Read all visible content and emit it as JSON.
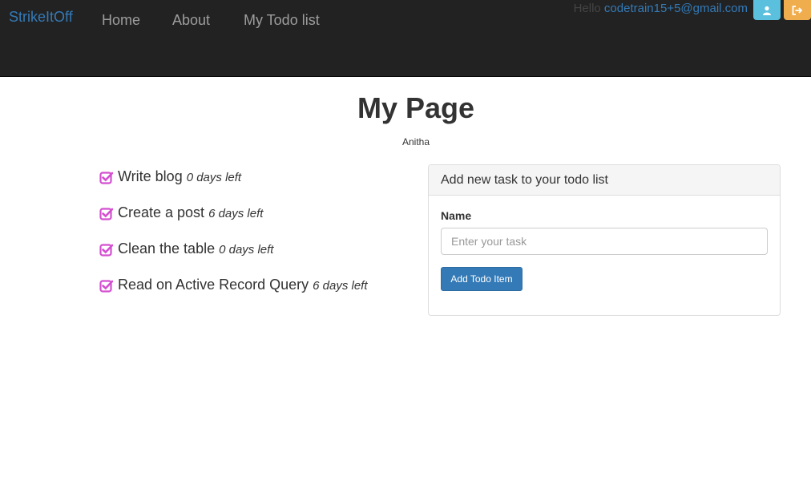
{
  "navbar": {
    "brand": "StrikeItOff",
    "links": [
      "Home",
      "About",
      "My Todo list"
    ],
    "greeting": "Hello",
    "user_email": "codetrain15+5@gmail.com",
    "buttons": [
      {
        "icon": "user-icon",
        "color": "#5bc0de"
      },
      {
        "icon": "logout-icon",
        "color": "#f0ad4e"
      }
    ]
  },
  "page": {
    "title": "My Page",
    "subtitle": "Anitha"
  },
  "todos": [
    {
      "name": "Write blog",
      "days_left": "0 days left",
      "icon": "checked-box-icon"
    },
    {
      "name": "Create a post",
      "days_left": "6 days left",
      "icon": "checked-box-icon"
    },
    {
      "name": "Clean the table",
      "days_left": "0 days left",
      "icon": "checked-box-icon"
    },
    {
      "name": "Read on Active Record Query",
      "days_left": "6 days left",
      "icon": "checked-box-icon"
    }
  ],
  "panel": {
    "heading": "Add new task to your todo list",
    "name_label": "Name",
    "input_placeholder": "Enter your task",
    "input_value": "",
    "submit_label": "Add Todo Item"
  },
  "colors": {
    "navbar_bg": "#222222",
    "brand": "#337ab7",
    "check_icon": "#d34fd0",
    "primary": "#337ab7"
  }
}
